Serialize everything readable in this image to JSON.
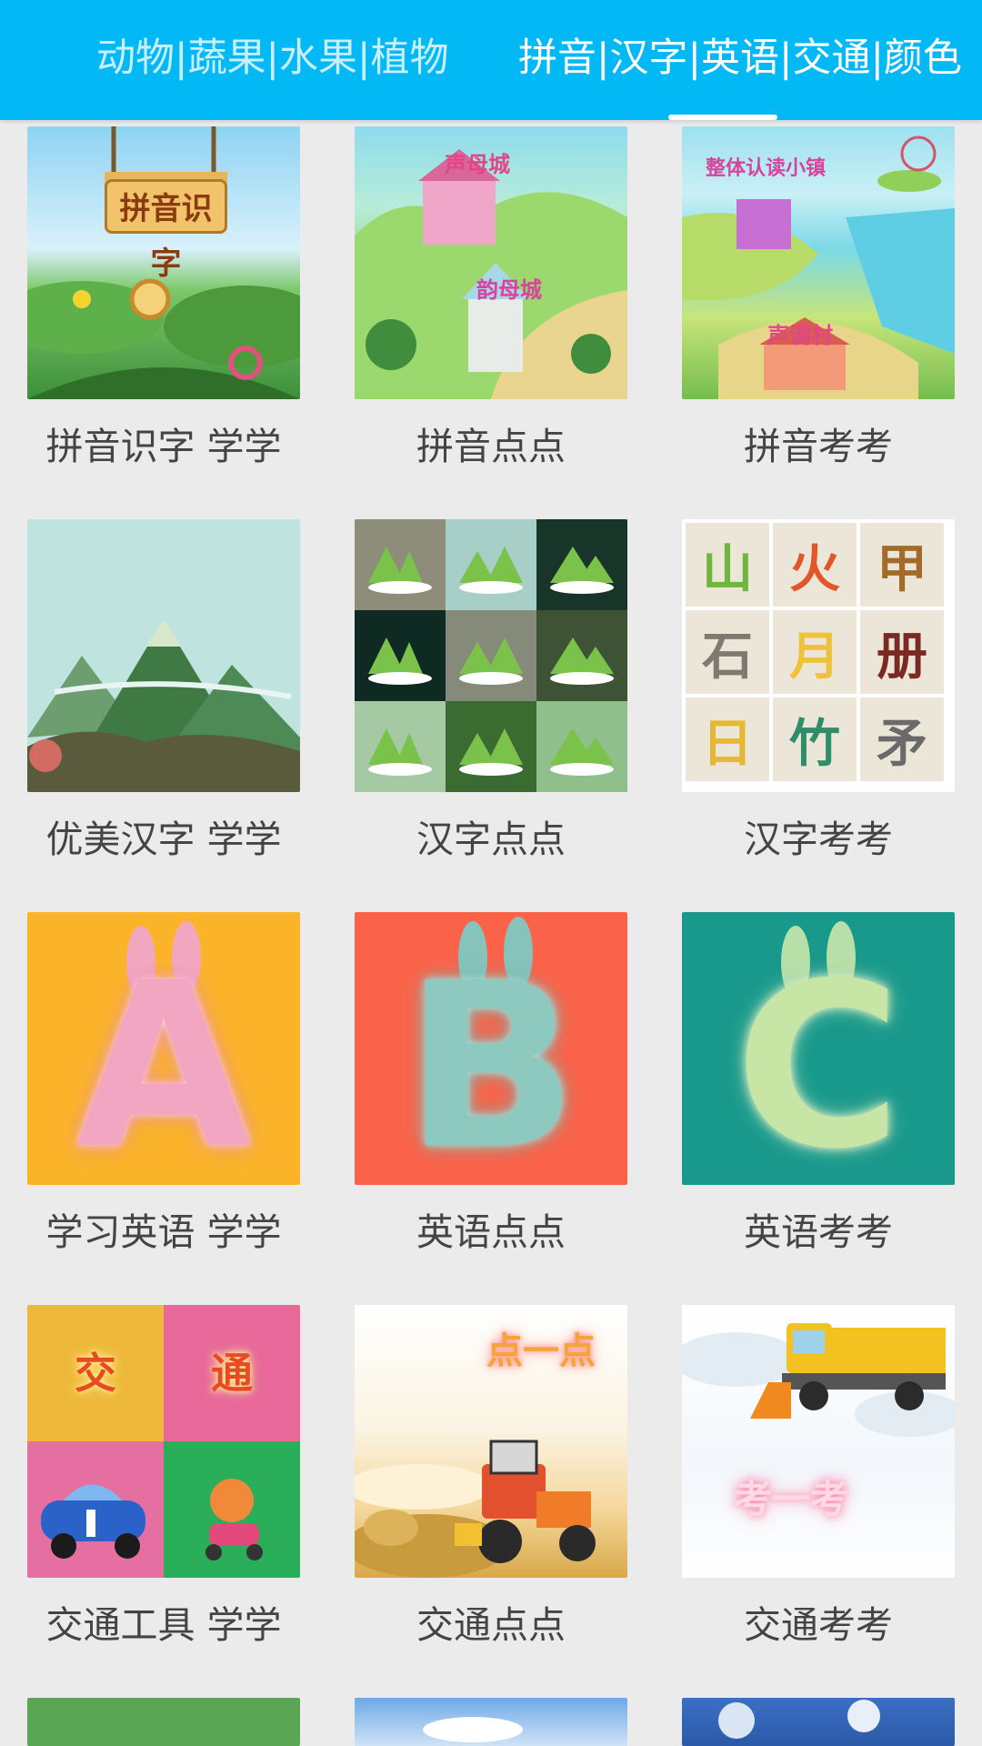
{
  "header": {
    "tab_1_label": "动物|蔬果|水果|植物",
    "tab_2_label": "拼音|汉字|英语|交通|颜色",
    "active_tab": 2
  },
  "colors": {
    "header_bg": "#03b9f5",
    "page_bg": "#ebebeb",
    "label_text": "#444444"
  },
  "grid": {
    "items": [
      {
        "label": "拼音识字 学学",
        "thumb": "pinyin-study-image",
        "sign_text": "拼音识字"
      },
      {
        "label": "拼音点点",
        "thumb": "pinyin-map-image",
        "sign_1": "声母城",
        "sign_2": "韵母城"
      },
      {
        "label": "拼音考考",
        "thumb": "pinyin-quiz-map-image",
        "sign_1": "整体认读小镇",
        "sign_2": "声调村"
      },
      {
        "label": "优美汉字 学学",
        "thumb": "mountains-image"
      },
      {
        "label": "汉字点点",
        "thumb": "mountain-tiles-image"
      },
      {
        "label": "汉字考考",
        "thumb": "character-tiles-image",
        "chars": [
          "山",
          "火",
          "甲",
          "石",
          "月",
          "册",
          "日",
          "竹",
          "矛"
        ]
      },
      {
        "label": "学习英语 学学",
        "thumb": "fluffy-letter-a-image",
        "letter": "A"
      },
      {
        "label": "英语点点",
        "thumb": "fluffy-letter-b-image",
        "letter": "B"
      },
      {
        "label": "英语考考",
        "thumb": "fluffy-letter-c-image",
        "letter": "C"
      },
      {
        "label": "交通工具 学学",
        "thumb": "traffic-tiles-image",
        "tile_1": "交",
        "tile_2": "通"
      },
      {
        "label": "交通点点",
        "thumb": "tractor-image",
        "banner": "点一点"
      },
      {
        "label": "交通考考",
        "thumb": "snowplow-truck-image",
        "banner": "考一考"
      },
      {
        "label": "",
        "thumb": "green-image"
      },
      {
        "label": "",
        "thumb": "sky-image"
      },
      {
        "label": "",
        "thumb": "blue-tree-image"
      }
    ]
  }
}
